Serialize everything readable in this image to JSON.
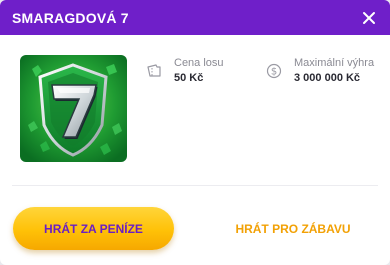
{
  "modal": {
    "title": "SMARAGDOVÁ 7",
    "close_icon": "close-icon"
  },
  "game": {
    "image_icon": "emerald-seven-logo",
    "price": {
      "label": "Cena losu",
      "value": "50 Kč",
      "icon": "ticket-icon"
    },
    "max_win": {
      "label": "Maximální výhra",
      "value": "3 000 000 Kč",
      "icon": "dollar-coin-icon"
    }
  },
  "actions": {
    "play_money": "HRÁT ZA PENÍZE",
    "play_fun": "HRÁT PRO ZÁBAVU"
  },
  "colors": {
    "header": "#6f1fc9",
    "accent_yellow": "#ffc107",
    "fun_orange": "#f2a105",
    "emerald": "#1fa33a"
  }
}
